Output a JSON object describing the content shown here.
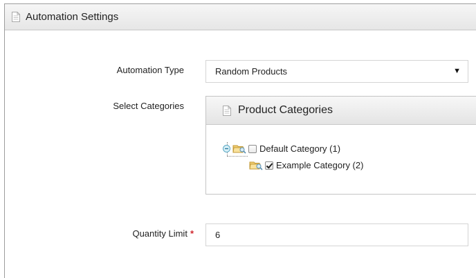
{
  "panel": {
    "title": "Automation Settings",
    "icon": "document-icon"
  },
  "automation_type": {
    "label": "Automation Type",
    "value": "Random Products"
  },
  "categories": {
    "label": "Select Categories",
    "box_title": "Product Categories",
    "tree": [
      {
        "label": "Default Category (1)",
        "checked": false,
        "expanded": true
      },
      {
        "label": "Example Category (2)",
        "checked": true
      }
    ]
  },
  "quantity": {
    "label": "Quantity Limit",
    "required_marker": "*",
    "value": "6"
  },
  "colors": {
    "required": "#d0282f",
    "border": "#d4d4d4"
  }
}
